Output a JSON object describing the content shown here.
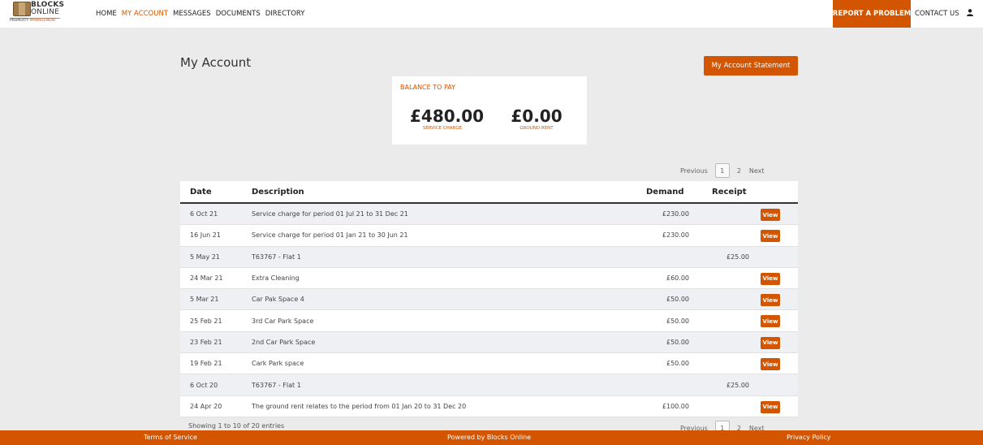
{
  "brand": {
    "line1": "BLOCKS",
    "line2": "ONLINE",
    "tagline_a": "PROPERTY",
    "tagline_b": "MANAGEMENT"
  },
  "nav": {
    "items": [
      {
        "label": "HOME",
        "active": false
      },
      {
        "label": "MY ACCOUNT",
        "active": true
      },
      {
        "label": "MESSAGES",
        "active": false
      },
      {
        "label": "DOCUMENTS",
        "active": false
      },
      {
        "label": "DIRECTORY",
        "active": false
      }
    ],
    "report_label": "REPORT A PROBLEM",
    "contact_label": "CONTACT US",
    "user_icon": "user-icon"
  },
  "page": {
    "title": "My Account",
    "statement_button": "My Account Statement"
  },
  "balance": {
    "label": "BALANCE TO PAY",
    "service_charge": {
      "amount": "£480.00",
      "label": "SERVICE CHARGE"
    },
    "ground_rent": {
      "amount": "£0.00",
      "label": "GROUND RENT"
    }
  },
  "pagination": {
    "previous": "Previous",
    "pages": [
      "1",
      "2"
    ],
    "current": "1",
    "next": "Next"
  },
  "table": {
    "headers": {
      "date": "Date",
      "description": "Description",
      "demand": "Demand",
      "receipt": "Receipt"
    },
    "view_label": "View",
    "rows": [
      {
        "date": "6 Oct 21",
        "description": "Service charge for period 01 Jul 21 to 31 Dec 21",
        "demand": "£230.00",
        "receipt": "",
        "view": true
      },
      {
        "date": "16 Jun 21",
        "description": "Service charge for period 01 Jan 21 to 30 Jun 21",
        "demand": "£230.00",
        "receipt": "",
        "view": true
      },
      {
        "date": "5 May 21",
        "description": "T63767 - Flat 1",
        "demand": "",
        "receipt": "£25.00",
        "view": false
      },
      {
        "date": "24 Mar 21",
        "description": "Extra Cleaning",
        "demand": "£60.00",
        "receipt": "",
        "view": true
      },
      {
        "date": "5 Mar 21",
        "description": "Car Pak Space 4",
        "demand": "£50.00",
        "receipt": "",
        "view": true
      },
      {
        "date": "25 Feb 21",
        "description": "3rd Car Park Space",
        "demand": "£50.00",
        "receipt": "",
        "view": true
      },
      {
        "date": "23 Feb 21",
        "description": "2nd Car Park Space",
        "demand": "£50.00",
        "receipt": "",
        "view": true
      },
      {
        "date": "19 Feb 21",
        "description": "Cark Park space",
        "demand": "£50.00",
        "receipt": "",
        "view": true
      },
      {
        "date": "6 Oct 20",
        "description": "T63767 - Flat 1",
        "demand": "",
        "receipt": "£25.00",
        "view": false
      },
      {
        "date": "24 Apr 20",
        "description": "The ground rent relates to the period from 01 Jan 20 to 31 Dec 20",
        "demand": "£100.00",
        "receipt": "",
        "view": true
      }
    ],
    "showing": "Showing 1 to 10 of 20 entries"
  },
  "footer": {
    "terms": "Terms of Service",
    "powered": "Powered by Blocks Online",
    "privacy": "Privacy Policy"
  },
  "colors": {
    "accent": "#d45500",
    "background": "#ebebeb",
    "row_alt": "#eef0f3"
  }
}
